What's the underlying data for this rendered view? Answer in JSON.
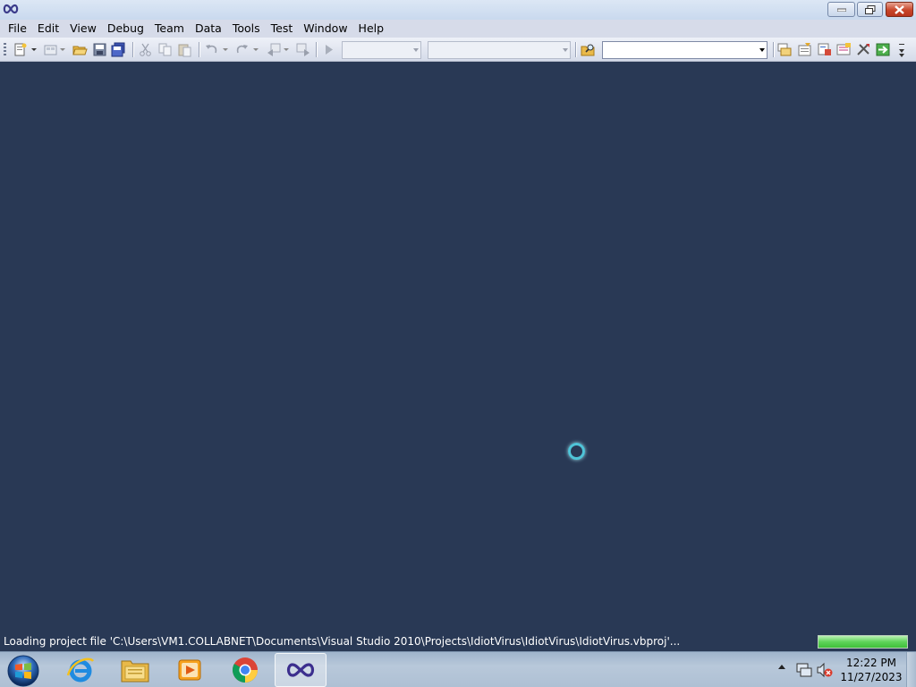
{
  "window": {
    "title": "",
    "icons": {
      "app": "vs-infinity-icon",
      "minimize": "minimize-icon",
      "maximize": "restore-icon",
      "close": "close-icon"
    }
  },
  "menu": {
    "items": [
      "File",
      "Edit",
      "View",
      "Debug",
      "Team",
      "Data",
      "Tools",
      "Test",
      "Window",
      "Help"
    ]
  },
  "toolbar": {
    "find_value": "",
    "solution_config_value": "",
    "solution_platform_value": "",
    "icons": [
      "new-project-icon",
      "add-item-icon",
      "open-file-icon",
      "save-icon",
      "save-all-icon",
      "cut-icon",
      "copy-icon",
      "paste-icon",
      "undo-icon",
      "redo-icon",
      "navigate-backward-icon",
      "navigate-forward-icon",
      "start-debugging-icon",
      "find-in-files-icon",
      "solution-explorer-icon",
      "properties-icon",
      "object-browser-icon",
      "toolbox-icon",
      "extension-manager-icon",
      "start-page-icon"
    ]
  },
  "workspace": {
    "background": "#293955",
    "spinner_color": "#4fc4d8"
  },
  "status": {
    "text": "Loading project file 'C:\\Users\\VM1.COLLABNET\\Documents\\Visual Studio 2010\\Projects\\IdiotVirus\\IdiotVirus\\IdiotVirus.vbproj'...",
    "progress": 1.0
  },
  "taskbar": {
    "apps": [
      "internet-explorer-icon",
      "windows-explorer-icon",
      "media-player-icon",
      "chrome-icon",
      "visual-studio-icon"
    ],
    "clock_time": "12:22 PM",
    "clock_date": "11/27/2023"
  }
}
